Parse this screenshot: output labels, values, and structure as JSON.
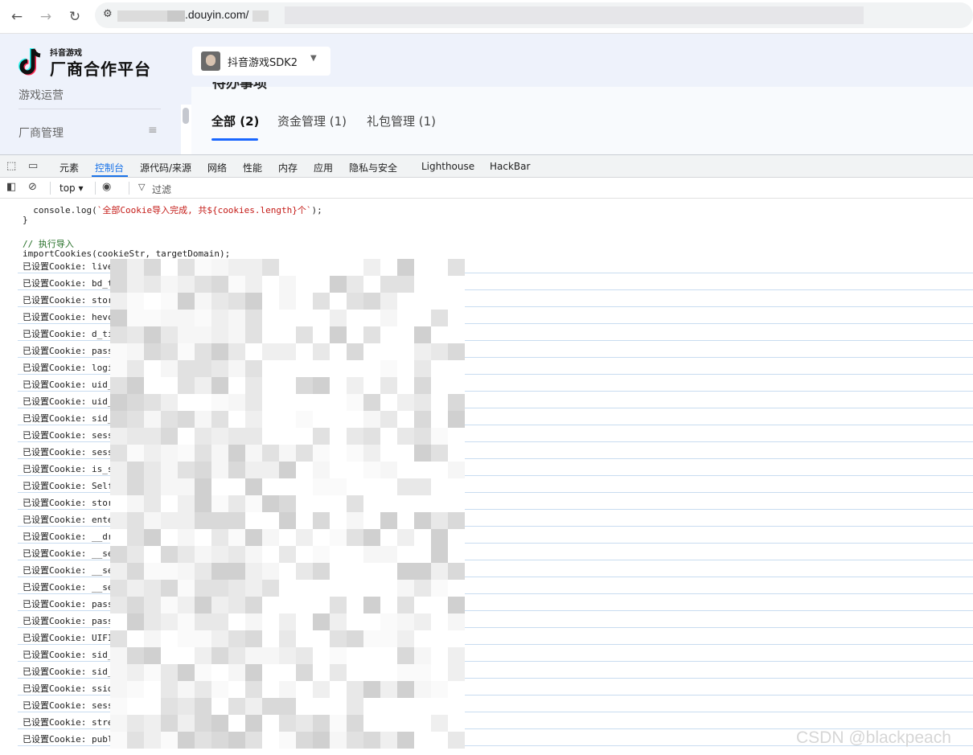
{
  "browser": {
    "back_icon": "←",
    "forward_icon": "→",
    "reload_icon": "↻",
    "url_visible": ".douyin.com/"
  },
  "app": {
    "logo_small": "抖音游戏",
    "logo_big": "厂商合作平台",
    "sidebar": {
      "item1": "游戏运营",
      "item2": "厂商管理"
    },
    "sdk_select": {
      "value": "抖音游戏SDK2"
    },
    "panel_title": "待办事项",
    "tabs": [
      {
        "label": "全部 (2)"
      },
      {
        "label": "资金管理 (1)"
      },
      {
        "label": "礼包管理 (1)"
      }
    ]
  },
  "devtools": {
    "tabs": [
      "元素",
      "控制台",
      "源代码/来源",
      "网络",
      "性能",
      "内存",
      "应用",
      "隐私与安全",
      "Lighthouse",
      "HackBar"
    ],
    "active_tab": "控制台",
    "context": "top ▾",
    "filter_label": "过滤",
    "code": {
      "line1_pre": "  console.log(",
      "line1_str": "`全部Cookie导入完成, 共${cookies.length}个`",
      "line1_post": ");",
      "line2": "}",
      "comment": "// 执行导入",
      "call": "importCookies(cookieStr, targetDomain);"
    },
    "logs": [
      "已设置Cookie: live",
      "已设置Cookie: bd_t",
      "已设置Cookie: stor",
      "已设置Cookie: hevc",
      "已设置Cookie: d_ti",
      "已设置Cookie: pass",
      "已设置Cookie: logi",
      "已设置Cookie: uid_",
      "已设置Cookie: uid_",
      "已设置Cookie: sid_",
      "已设置Cookie: sess",
      "已设置Cookie: sess",
      "已设置Cookie: is_s",
      "已设置Cookie: Self",
      "已设置Cookie: stor",
      "已设置Cookie: ente",
      "已设置Cookie: __dr",
      "已设置Cookie: __se",
      "已设置Cookie: __se",
      "已设置Cookie: __se",
      "已设置Cookie: pass",
      "已设置Cookie: pass",
      "已设置Cookie: UIFI",
      "已设置Cookie: sid_",
      "已设置Cookie: sid_",
      "已设置Cookie: ssid",
      "已设置Cookie: sess",
      "已设置Cookie: stre",
      "已设置Cookie: publ"
    ]
  },
  "watermark": "CSDN @blackpeach"
}
